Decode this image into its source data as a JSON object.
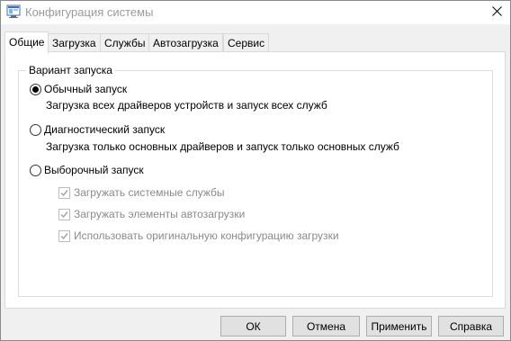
{
  "window": {
    "title": "Конфигурация системы",
    "title_color": "#9a9a9a",
    "close_icon": "close-icon",
    "app_icon": "msconfig-icon"
  },
  "tabs": [
    {
      "label": "Общие",
      "active": true
    },
    {
      "label": "Загрузка",
      "active": false
    },
    {
      "label": "Службы",
      "active": false
    },
    {
      "label": "Автозагрузка",
      "active": false
    },
    {
      "label": "Сервис",
      "active": false
    }
  ],
  "startup_group": {
    "legend": "Вариант запуска",
    "options": [
      {
        "label": "Обычный запуск",
        "description": "Загрузка всех драйверов устройств и запуск всех служб",
        "selected": true
      },
      {
        "label": "Диагностический запуск",
        "description": "Загрузка только основных драйверов и запуск только основных служб",
        "selected": false
      },
      {
        "label": "Выборочный запуск",
        "selected": false
      }
    ],
    "selective_checks": [
      {
        "label": "Загружать системные службы",
        "checked": true,
        "enabled": false
      },
      {
        "label": "Загружать элементы автозагрузки",
        "checked": true,
        "enabled": false
      },
      {
        "label": "Использовать оригинальную конфигурацию загрузки",
        "checked": true,
        "enabled": false
      }
    ]
  },
  "buttons": {
    "ok": "ОК",
    "cancel": "Отмена",
    "apply": "Применить",
    "help": "Справка"
  }
}
